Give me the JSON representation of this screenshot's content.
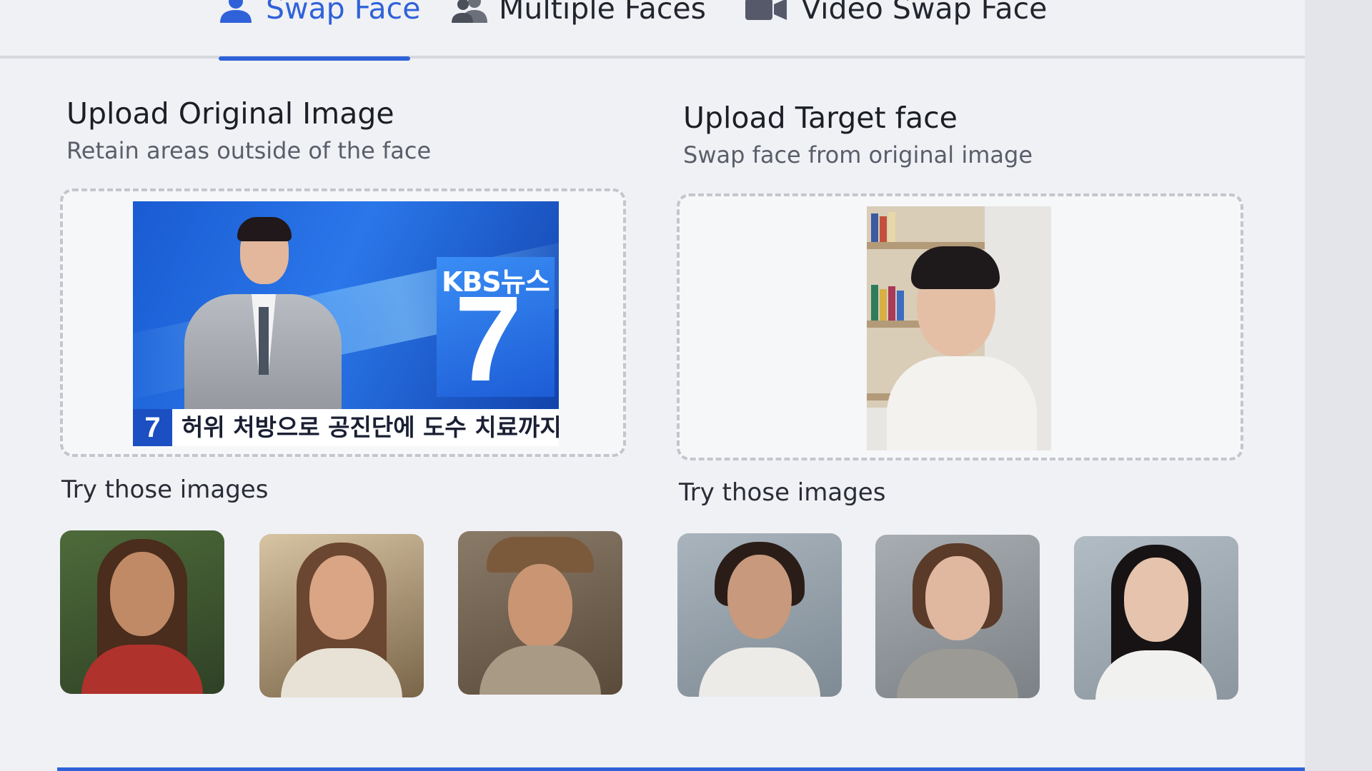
{
  "tabs": [
    {
      "label": "Swap Face",
      "icon": "person-icon",
      "active": true
    },
    {
      "label": "Multiple Faces",
      "icon": "people-icon",
      "active": false
    },
    {
      "label": "Video Swap Face",
      "icon": "video-icon",
      "active": false
    }
  ],
  "original": {
    "title": "Upload Original Image",
    "subtitle": "Retain areas outside of the face",
    "preview": {
      "logo": "KBS뉴스",
      "number": "7",
      "badge": "7",
      "caption": "허위 처방으로 공진단에 도수 치료까지"
    },
    "try_label": "Try those images"
  },
  "target": {
    "title": "Upload Target face",
    "subtitle": "Swap face from original image",
    "try_label": "Try those images"
  },
  "colors": {
    "accent": "#2f62d9",
    "panel": "#f0f1f5",
    "dashed_border": "#c3c6cd"
  }
}
